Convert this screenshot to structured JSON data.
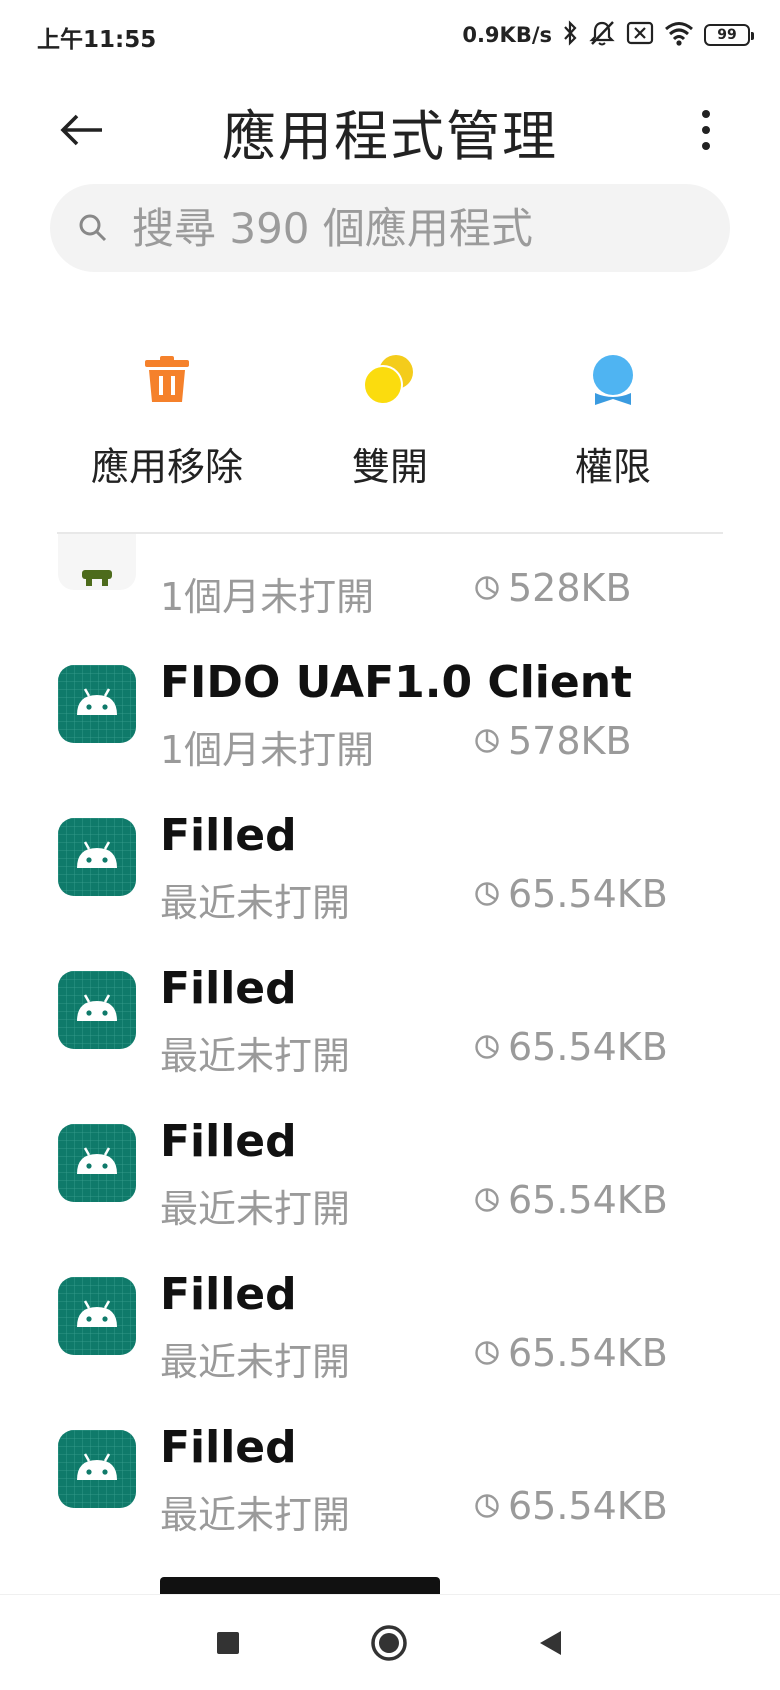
{
  "status_bar": {
    "time": "上午11:55",
    "net_speed": "0.9KB/s",
    "battery": "99",
    "icons": [
      "bluetooth-icon",
      "mute-icon",
      "sim-off-icon",
      "wifi-icon",
      "battery-icon"
    ]
  },
  "header": {
    "title": "應用程式管理"
  },
  "search": {
    "placeholder": "搜尋 390 個應用程式"
  },
  "shortcuts": [
    {
      "label": "應用移除",
      "icon": "trash-icon",
      "color": "#f5812b"
    },
    {
      "label": "雙開",
      "icon": "dual-circles-icon",
      "color": "#f4cc1b"
    },
    {
      "label": "權限",
      "icon": "permission-badge-icon",
      "color": "#4fb4f2"
    }
  ],
  "apps": [
    {
      "name": "",
      "status": "1個月未打開",
      "size": "528KB",
      "icon": "partial-app-icon"
    },
    {
      "name": "FIDO UAF1.0 Client",
      "status": "1個月未打開",
      "size": "578KB",
      "icon": "android-app-icon"
    },
    {
      "name": "Filled",
      "status": "最近未打開",
      "size": "65.54KB",
      "icon": "android-app-icon"
    },
    {
      "name": "Filled",
      "status": "最近未打開",
      "size": "65.54KB",
      "icon": "android-app-icon"
    },
    {
      "name": "Filled",
      "status": "最近未打開",
      "size": "65.54KB",
      "icon": "android-app-icon"
    },
    {
      "name": "Filled",
      "status": "最近未打開",
      "size": "65.54KB",
      "icon": "android-app-icon"
    },
    {
      "name": "Filled",
      "status": "最近未打開",
      "size": "65.54KB",
      "icon": "android-app-icon"
    }
  ],
  "colors": {
    "android_icon_bg": "#0f7a6a",
    "muted_text": "#9a9a9a"
  }
}
